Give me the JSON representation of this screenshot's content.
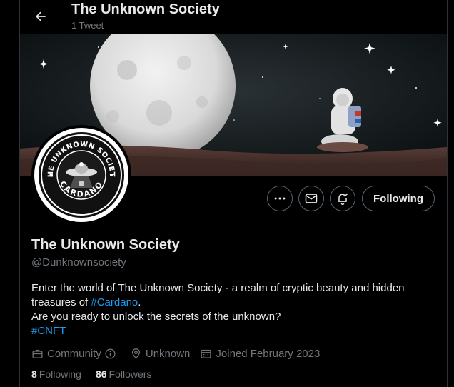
{
  "header": {
    "title": "The Unknown Society",
    "subtitle": "1 Tweet"
  },
  "avatar": {
    "text_top": "THE UNKNOWN SOCIETY",
    "text_bottom": "CARDANO"
  },
  "actions": {
    "follow_label": "Following"
  },
  "profile": {
    "name": "The Unknown Society",
    "handle": "@Dunknownsociety",
    "bio_line1": "Enter the world of The Unknown Society - a realm of cryptic beauty and hidden",
    "bio_line2_prefix": "treasures of ",
    "bio_tag1": "#Cardano",
    "bio_line2_suffix": ".",
    "bio_line3": "Are you ready to unlock the secrets of the unknown?",
    "bio_tag2": "#CNFT"
  },
  "meta": {
    "category": "Community",
    "location": "Unknown",
    "joined": "Joined February 2023"
  },
  "stats": {
    "following_count": "8",
    "following_label": "Following",
    "followers_count": "86",
    "followers_label": "Followers"
  },
  "colors": {
    "accent": "#1d9bf0",
    "muted": "#71767b",
    "text": "#e7e9ea",
    "background": "#000000"
  }
}
